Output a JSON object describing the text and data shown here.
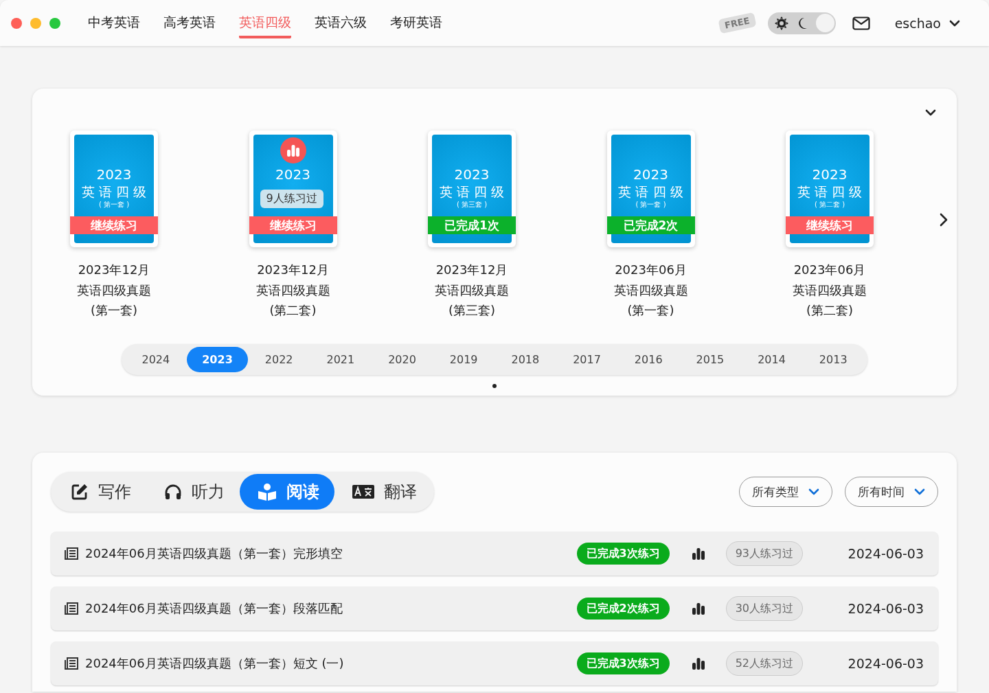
{
  "nav": {
    "tabs": [
      {
        "label": "中考英语",
        "selected": false
      },
      {
        "label": "高考英语",
        "selected": false
      },
      {
        "label": "英语四级",
        "selected": true
      },
      {
        "label": "英语六级",
        "selected": false
      },
      {
        "label": "考研英语",
        "selected": false
      }
    ],
    "badge": "FREE",
    "dark_mode": false,
    "user": "eschao"
  },
  "shelf": {
    "books": [
      {
        "cover_year": "2023",
        "cover_title": "英 语 四 级",
        "cover_set": "( 第一套 )",
        "kind": "continue",
        "status_label": "继续练习",
        "hot": false,
        "title": [
          "2023年12月",
          "英语四级真题",
          "(第一套)"
        ]
      },
      {
        "cover_year": "2023",
        "hot": true,
        "tooltip": "9人练习过",
        "kind": "continue",
        "status_label": "继续练习",
        "title": [
          "2023年12月",
          "英语四级真题",
          "(第二套)"
        ]
      },
      {
        "cover_year": "2023",
        "cover_title": "英 语 四 级",
        "cover_set": "( 第三套 )",
        "kind": "done",
        "status_label": "已完成1次",
        "hot": false,
        "title": [
          "2023年12月",
          "英语四级真题",
          "(第三套)"
        ]
      },
      {
        "cover_year": "2023",
        "cover_title": "英 语 四 级",
        "cover_set": "( 第一套 )",
        "kind": "done",
        "status_label": "已完成2次",
        "hot": false,
        "title": [
          "2023年06月",
          "英语四级真题",
          "(第一套)"
        ]
      },
      {
        "cover_year": "2023",
        "cover_title": "英 语 四 级",
        "cover_set": "( 第二套 )",
        "kind": "continue",
        "status_label": "继续练习",
        "hot": false,
        "title": [
          "2023年06月",
          "英语四级真题",
          "(第二套)"
        ]
      }
    ],
    "years": [
      {
        "label": "2024",
        "selected": false
      },
      {
        "label": "2023",
        "selected": true
      },
      {
        "label": "2022",
        "selected": false
      },
      {
        "label": "2021",
        "selected": false
      },
      {
        "label": "2020",
        "selected": false
      },
      {
        "label": "2019",
        "selected": false
      },
      {
        "label": "2018",
        "selected": false
      },
      {
        "label": "2017",
        "selected": false
      },
      {
        "label": "2016",
        "selected": false
      },
      {
        "label": "2015",
        "selected": false
      },
      {
        "label": "2014",
        "selected": false
      },
      {
        "label": "2013",
        "selected": false
      }
    ]
  },
  "practice": {
    "tabs": [
      {
        "label": "写作",
        "selected": false
      },
      {
        "label": "听力",
        "selected": false
      },
      {
        "label": "阅读",
        "selected": true
      },
      {
        "label": "翻译",
        "selected": false
      }
    ],
    "filters": [
      "所有类型",
      "所有时间"
    ],
    "rows": [
      {
        "title": "2024年06月英语四级真题（第一套）完形填空",
        "status": "已完成3次练习",
        "count": "93人练习过",
        "date": "2024-06-03"
      },
      {
        "title": "2024年06月英语四级真题（第一套）段落匹配",
        "status": "已完成2次练习",
        "count": "30人练习过",
        "date": "2024-06-03"
      },
      {
        "title": "2024年06月英语四级真题（第一套）短文 (一)",
        "status": "已完成3次练习",
        "count": "52人练习过",
        "date": "2024-06-03"
      }
    ]
  }
}
